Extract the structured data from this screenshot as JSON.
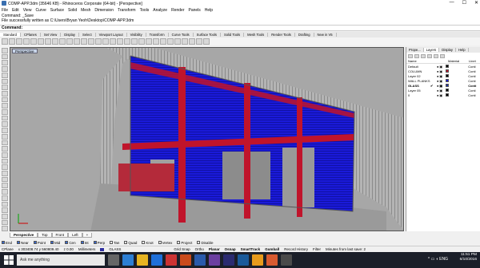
{
  "window": {
    "title": "COMP-APP.3dm (35646 KB) - Rhinoceros Corporate (64-bit) - [Perspective]",
    "controls": [
      "—",
      "☐",
      "✕"
    ]
  },
  "menu": [
    "File",
    "Edit",
    "View",
    "Curve",
    "Surface",
    "Solid",
    "Mesh",
    "Dimension",
    "Transform",
    "Tools",
    "Analyze",
    "Render",
    "Panels",
    "Help"
  ],
  "command_history": [
    "Command: _Save",
    "File successfully written as C:\\Users\\Bryan Yeoh\\Desktop\\COMP-APP.3dm"
  ],
  "command": {
    "label": "Command:",
    "value": ""
  },
  "toolbar_tabs": [
    "Standard",
    "CPlanes",
    "Set View",
    "Display",
    "Select",
    "Viewport Layout",
    "Visibility",
    "Transform",
    "Curve Tools",
    "Surface Tools",
    "Solid Tools",
    "Mesh Tools",
    "Render Tools",
    "Drafting",
    "New in V5"
  ],
  "viewport": {
    "title": "Perspective"
  },
  "panel": {
    "tabs": [
      "Prope...",
      "Layers",
      "Display",
      "Help"
    ],
    "columns": {
      "name": "Name",
      "material": "Material",
      "linetype": "Linet"
    },
    "layers": [
      {
        "name": "Default",
        "color": "#000000",
        "linetype": "Conti"
      },
      {
        "name": "COLUMN",
        "color": "#c0142b",
        "linetype": "Conti"
      },
      {
        "name": "Layer 02",
        "color": "#000000",
        "linetype": "Conti"
      },
      {
        "name": "WALL PLANKS",
        "color": "#1515d8",
        "linetype": "Conti"
      },
      {
        "name": "GLASS",
        "color": "#2030a0",
        "linetype": "Conti",
        "check": "✔"
      },
      {
        "name": "Layer 05",
        "color": "#000000",
        "linetype": "Conti"
      },
      {
        "name": "0",
        "color": "#000000",
        "linetype": "Conti"
      }
    ]
  },
  "viewport_tabs": [
    "Perspective",
    "Top",
    "Front",
    "Left",
    "+"
  ],
  "osnaps": [
    {
      "label": "End",
      "on": true
    },
    {
      "label": "Near",
      "on": true
    },
    {
      "label": "Point",
      "on": true
    },
    {
      "label": "Mid",
      "on": true
    },
    {
      "label": "Cen",
      "on": true
    },
    {
      "label": "Int",
      "on": true
    },
    {
      "label": "Perp",
      "on": true
    },
    {
      "label": "Tan",
      "on": false
    },
    {
      "label": "Quad",
      "on": false
    },
    {
      "label": "Knot",
      "on": false
    },
    {
      "label": "Vertex",
      "on": false
    },
    {
      "label": "Project",
      "on": false
    },
    {
      "label": "Disable",
      "on": false
    }
  ],
  "status": {
    "cplane": "CPlane",
    "coords": "x 303408.74  y 560809.40",
    "z": "z 0.00",
    "units": "Millimeters",
    "layer": "GLASS",
    "items": [
      "Grid Snap",
      "Ortho",
      "Planar",
      "Osnap",
      "SmartTrack",
      "Gumball",
      "Record History",
      "Filter"
    ],
    "message": "Minutes from last save: 2"
  },
  "taskbar": {
    "search_placeholder": "Ask me anything",
    "tray_icons": "^ ▭ ◖ ENG",
    "time": "11:51 PM",
    "date": "6/10/2016"
  },
  "colors": {
    "column_red": "#c0142b",
    "plank_blue": "#1515d8",
    "viewport_gray": "#a7a7a7"
  }
}
